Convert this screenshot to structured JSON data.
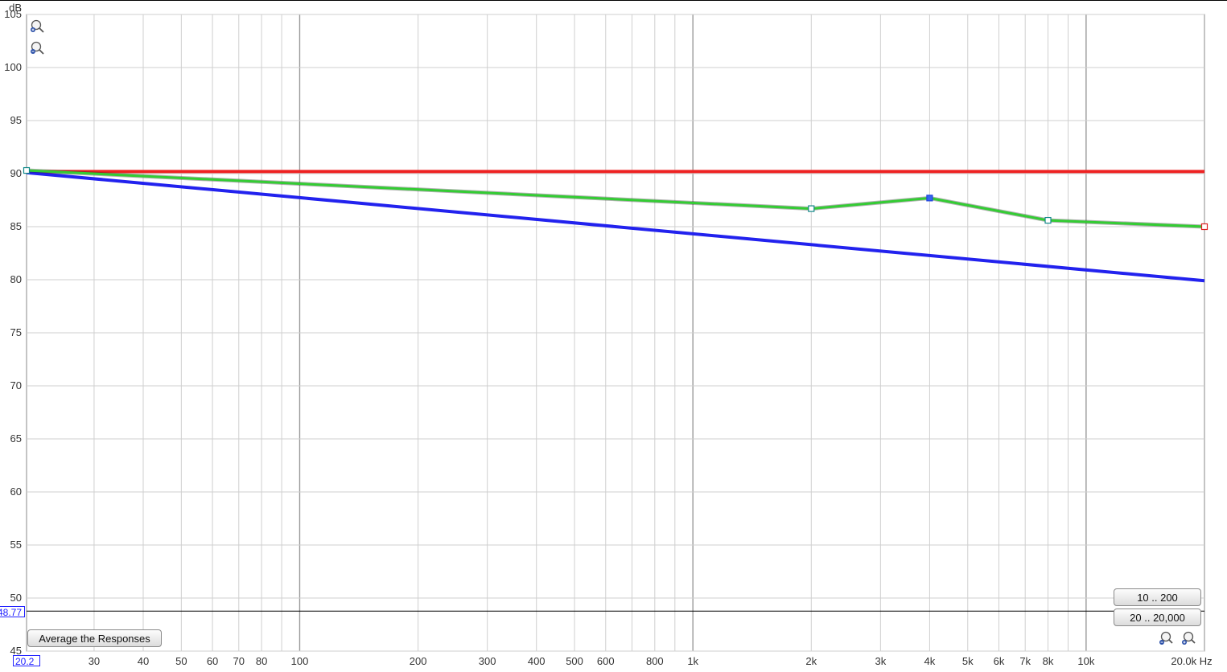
{
  "chart_data": {
    "type": "line",
    "x_scale": "log",
    "xlim": [
      20.2,
      20000
    ],
    "ylim": [
      45,
      105
    ],
    "ylabel": "dB",
    "xunit": "Hz",
    "grid": true,
    "y_ticks": [
      45,
      50,
      55,
      60,
      65,
      70,
      75,
      80,
      85,
      90,
      95,
      100,
      105
    ],
    "x_ticks": [
      {
        "value": 30,
        "label": "30"
      },
      {
        "value": 40,
        "label": "40"
      },
      {
        "value": 50,
        "label": "50"
      },
      {
        "value": 60,
        "label": "60"
      },
      {
        "value": 70,
        "label": "70"
      },
      {
        "value": 80,
        "label": "80"
      },
      {
        "value": 100,
        "label": "100"
      },
      {
        "value": 200,
        "label": "200"
      },
      {
        "value": 300,
        "label": "300"
      },
      {
        "value": 400,
        "label": "400"
      },
      {
        "value": 500,
        "label": "500"
      },
      {
        "value": 600,
        "label": "600"
      },
      {
        "value": 800,
        "label": "800"
      },
      {
        "value": 1000,
        "label": "1k"
      },
      {
        "value": 2000,
        "label": "2k"
      },
      {
        "value": 3000,
        "label": "3k"
      },
      {
        "value": 4000,
        "label": "4k"
      },
      {
        "value": 5000,
        "label": "5k"
      },
      {
        "value": 6000,
        "label": "6k"
      },
      {
        "value": 7000,
        "label": "7k"
      },
      {
        "value": 8000,
        "label": "8k"
      },
      {
        "value": 10000,
        "label": "10k"
      },
      {
        "value": 20000,
        "label": "20.0k Hz"
      }
    ],
    "series": [
      {
        "color": "#ee2222",
        "x": [
          20.2,
          20000
        ],
        "y": [
          90.2,
          90.2
        ]
      },
      {
        "color": "#2222ee",
        "x": [
          20.2,
          20000
        ],
        "y": [
          90.1,
          79.9
        ]
      },
      {
        "color": "#33cc33",
        "x": [
          20.2,
          2000,
          4000,
          8000,
          20000
        ],
        "y": [
          90.3,
          86.7,
          87.7,
          85.6,
          85.0
        ],
        "markers": [
          {
            "x": 20.2,
            "y": 90.3,
            "stroke": "#118888",
            "fill": "#ffffff"
          },
          {
            "x": 2000,
            "y": 86.7,
            "stroke": "#118888",
            "fill": "#ffffff"
          },
          {
            "x": 4000,
            "y": 87.7,
            "stroke": "#2244dd",
            "fill": "#3366ee"
          },
          {
            "x": 8000,
            "y": 85.6,
            "stroke": "#118888",
            "fill": "#ffffff"
          },
          {
            "x": 20000,
            "y": 85.0,
            "stroke": "#dd2222",
            "fill": "#ffffff"
          }
        ]
      }
    ],
    "cursor": {
      "x": 20.2,
      "y": 48.77
    }
  },
  "readouts": {
    "x_readout": "20.2",
    "y_readout": "48.77"
  },
  "buttons": {
    "average": "Average the Responses",
    "range_a": "10 .. 200",
    "range_b": "20 .. 20,000"
  },
  "icons": [
    "zoom-in-icon",
    "zoom-out-icon"
  ]
}
